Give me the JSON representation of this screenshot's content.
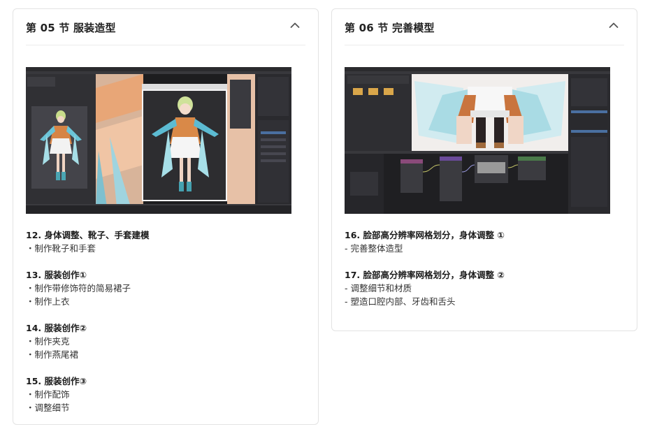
{
  "sections": [
    {
      "title": "第 05 节 服装造型",
      "lessons": [
        {
          "title": "12. 身体调整、靴子、手套建模",
          "items": [
            "・制作靴子和手套"
          ]
        },
        {
          "title": "13. 服装创作①",
          "items": [
            "・制作带修饰符的简易裙子",
            "・制作上衣"
          ]
        },
        {
          "title": "14. 服装创作②",
          "items": [
            "・制作夹克",
            "・制作燕尾裙"
          ]
        },
        {
          "title": "15. 服装创作③",
          "items": [
            "・制作配饰",
            "・调整细节"
          ]
        }
      ]
    },
    {
      "title": "第 06 节 完善模型",
      "lessons": [
        {
          "title": "16. 脸部高分辨率网格划分，身体调整 ①",
          "items": [
            "- 完善整体造型"
          ]
        },
        {
          "title": "17. 脸部高分辨率网格划分，身体调整 ②",
          "items": [
            "- 调整细节和材质",
            "- 塑造口腔内部、牙齿和舌头"
          ]
        }
      ]
    }
  ],
  "colors": {
    "card_border": "#e3e3e3",
    "title_text": "#222222",
    "body_text": "#333333",
    "editor_bg": "#1d1d1f"
  },
  "icons": {
    "collapse": "chevron-up-icon"
  }
}
